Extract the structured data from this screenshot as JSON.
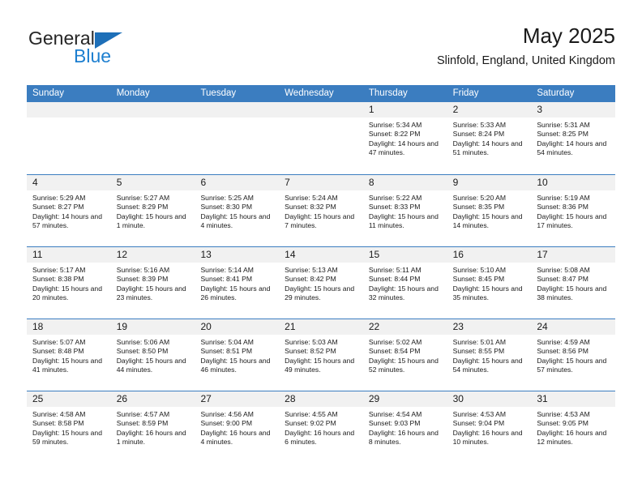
{
  "brand": {
    "name_top": "General",
    "name_bottom": "Blue",
    "triangle_color": "#1d6fb8",
    "blue_color": "#1d7fd0"
  },
  "header": {
    "title": "May 2025",
    "subtitle": "Slinfold, England, United Kingdom"
  },
  "theme": {
    "header_blue": "#3b7dc0",
    "daynum_bg": "#f1f1f1",
    "text": "#1a1a1a"
  },
  "weekdays": [
    "Sunday",
    "Monday",
    "Tuesday",
    "Wednesday",
    "Thursday",
    "Friday",
    "Saturday"
  ],
  "weeks": [
    [
      {
        "day": "",
        "sunrise": "",
        "sunset": "",
        "daylight": ""
      },
      {
        "day": "",
        "sunrise": "",
        "sunset": "",
        "daylight": ""
      },
      {
        "day": "",
        "sunrise": "",
        "sunset": "",
        "daylight": ""
      },
      {
        "day": "",
        "sunrise": "",
        "sunset": "",
        "daylight": ""
      },
      {
        "day": "1",
        "sunrise": "Sunrise: 5:34 AM",
        "sunset": "Sunset: 8:22 PM",
        "daylight": "Daylight: 14 hours and 47 minutes."
      },
      {
        "day": "2",
        "sunrise": "Sunrise: 5:33 AM",
        "sunset": "Sunset: 8:24 PM",
        "daylight": "Daylight: 14 hours and 51 minutes."
      },
      {
        "day": "3",
        "sunrise": "Sunrise: 5:31 AM",
        "sunset": "Sunset: 8:25 PM",
        "daylight": "Daylight: 14 hours and 54 minutes."
      }
    ],
    [
      {
        "day": "4",
        "sunrise": "Sunrise: 5:29 AM",
        "sunset": "Sunset: 8:27 PM",
        "daylight": "Daylight: 14 hours and 57 minutes."
      },
      {
        "day": "5",
        "sunrise": "Sunrise: 5:27 AM",
        "sunset": "Sunset: 8:29 PM",
        "daylight": "Daylight: 15 hours and 1 minute."
      },
      {
        "day": "6",
        "sunrise": "Sunrise: 5:25 AM",
        "sunset": "Sunset: 8:30 PM",
        "daylight": "Daylight: 15 hours and 4 minutes."
      },
      {
        "day": "7",
        "sunrise": "Sunrise: 5:24 AM",
        "sunset": "Sunset: 8:32 PM",
        "daylight": "Daylight: 15 hours and 7 minutes."
      },
      {
        "day": "8",
        "sunrise": "Sunrise: 5:22 AM",
        "sunset": "Sunset: 8:33 PM",
        "daylight": "Daylight: 15 hours and 11 minutes."
      },
      {
        "day": "9",
        "sunrise": "Sunrise: 5:20 AM",
        "sunset": "Sunset: 8:35 PM",
        "daylight": "Daylight: 15 hours and 14 minutes."
      },
      {
        "day": "10",
        "sunrise": "Sunrise: 5:19 AM",
        "sunset": "Sunset: 8:36 PM",
        "daylight": "Daylight: 15 hours and 17 minutes."
      }
    ],
    [
      {
        "day": "11",
        "sunrise": "Sunrise: 5:17 AM",
        "sunset": "Sunset: 8:38 PM",
        "daylight": "Daylight: 15 hours and 20 minutes."
      },
      {
        "day": "12",
        "sunrise": "Sunrise: 5:16 AM",
        "sunset": "Sunset: 8:39 PM",
        "daylight": "Daylight: 15 hours and 23 minutes."
      },
      {
        "day": "13",
        "sunrise": "Sunrise: 5:14 AM",
        "sunset": "Sunset: 8:41 PM",
        "daylight": "Daylight: 15 hours and 26 minutes."
      },
      {
        "day": "14",
        "sunrise": "Sunrise: 5:13 AM",
        "sunset": "Sunset: 8:42 PM",
        "daylight": "Daylight: 15 hours and 29 minutes."
      },
      {
        "day": "15",
        "sunrise": "Sunrise: 5:11 AM",
        "sunset": "Sunset: 8:44 PM",
        "daylight": "Daylight: 15 hours and 32 minutes."
      },
      {
        "day": "16",
        "sunrise": "Sunrise: 5:10 AM",
        "sunset": "Sunset: 8:45 PM",
        "daylight": "Daylight: 15 hours and 35 minutes."
      },
      {
        "day": "17",
        "sunrise": "Sunrise: 5:08 AM",
        "sunset": "Sunset: 8:47 PM",
        "daylight": "Daylight: 15 hours and 38 minutes."
      }
    ],
    [
      {
        "day": "18",
        "sunrise": "Sunrise: 5:07 AM",
        "sunset": "Sunset: 8:48 PM",
        "daylight": "Daylight: 15 hours and 41 minutes."
      },
      {
        "day": "19",
        "sunrise": "Sunrise: 5:06 AM",
        "sunset": "Sunset: 8:50 PM",
        "daylight": "Daylight: 15 hours and 44 minutes."
      },
      {
        "day": "20",
        "sunrise": "Sunrise: 5:04 AM",
        "sunset": "Sunset: 8:51 PM",
        "daylight": "Daylight: 15 hours and 46 minutes."
      },
      {
        "day": "21",
        "sunrise": "Sunrise: 5:03 AM",
        "sunset": "Sunset: 8:52 PM",
        "daylight": "Daylight: 15 hours and 49 minutes."
      },
      {
        "day": "22",
        "sunrise": "Sunrise: 5:02 AM",
        "sunset": "Sunset: 8:54 PM",
        "daylight": "Daylight: 15 hours and 52 minutes."
      },
      {
        "day": "23",
        "sunrise": "Sunrise: 5:01 AM",
        "sunset": "Sunset: 8:55 PM",
        "daylight": "Daylight: 15 hours and 54 minutes."
      },
      {
        "day": "24",
        "sunrise": "Sunrise: 4:59 AM",
        "sunset": "Sunset: 8:56 PM",
        "daylight": "Daylight: 15 hours and 57 minutes."
      }
    ],
    [
      {
        "day": "25",
        "sunrise": "Sunrise: 4:58 AM",
        "sunset": "Sunset: 8:58 PM",
        "daylight": "Daylight: 15 hours and 59 minutes."
      },
      {
        "day": "26",
        "sunrise": "Sunrise: 4:57 AM",
        "sunset": "Sunset: 8:59 PM",
        "daylight": "Daylight: 16 hours and 1 minute."
      },
      {
        "day": "27",
        "sunrise": "Sunrise: 4:56 AM",
        "sunset": "Sunset: 9:00 PM",
        "daylight": "Daylight: 16 hours and 4 minutes."
      },
      {
        "day": "28",
        "sunrise": "Sunrise: 4:55 AM",
        "sunset": "Sunset: 9:02 PM",
        "daylight": "Daylight: 16 hours and 6 minutes."
      },
      {
        "day": "29",
        "sunrise": "Sunrise: 4:54 AM",
        "sunset": "Sunset: 9:03 PM",
        "daylight": "Daylight: 16 hours and 8 minutes."
      },
      {
        "day": "30",
        "sunrise": "Sunrise: 4:53 AM",
        "sunset": "Sunset: 9:04 PM",
        "daylight": "Daylight: 16 hours and 10 minutes."
      },
      {
        "day": "31",
        "sunrise": "Sunrise: 4:53 AM",
        "sunset": "Sunset: 9:05 PM",
        "daylight": "Daylight: 16 hours and 12 minutes."
      }
    ]
  ]
}
